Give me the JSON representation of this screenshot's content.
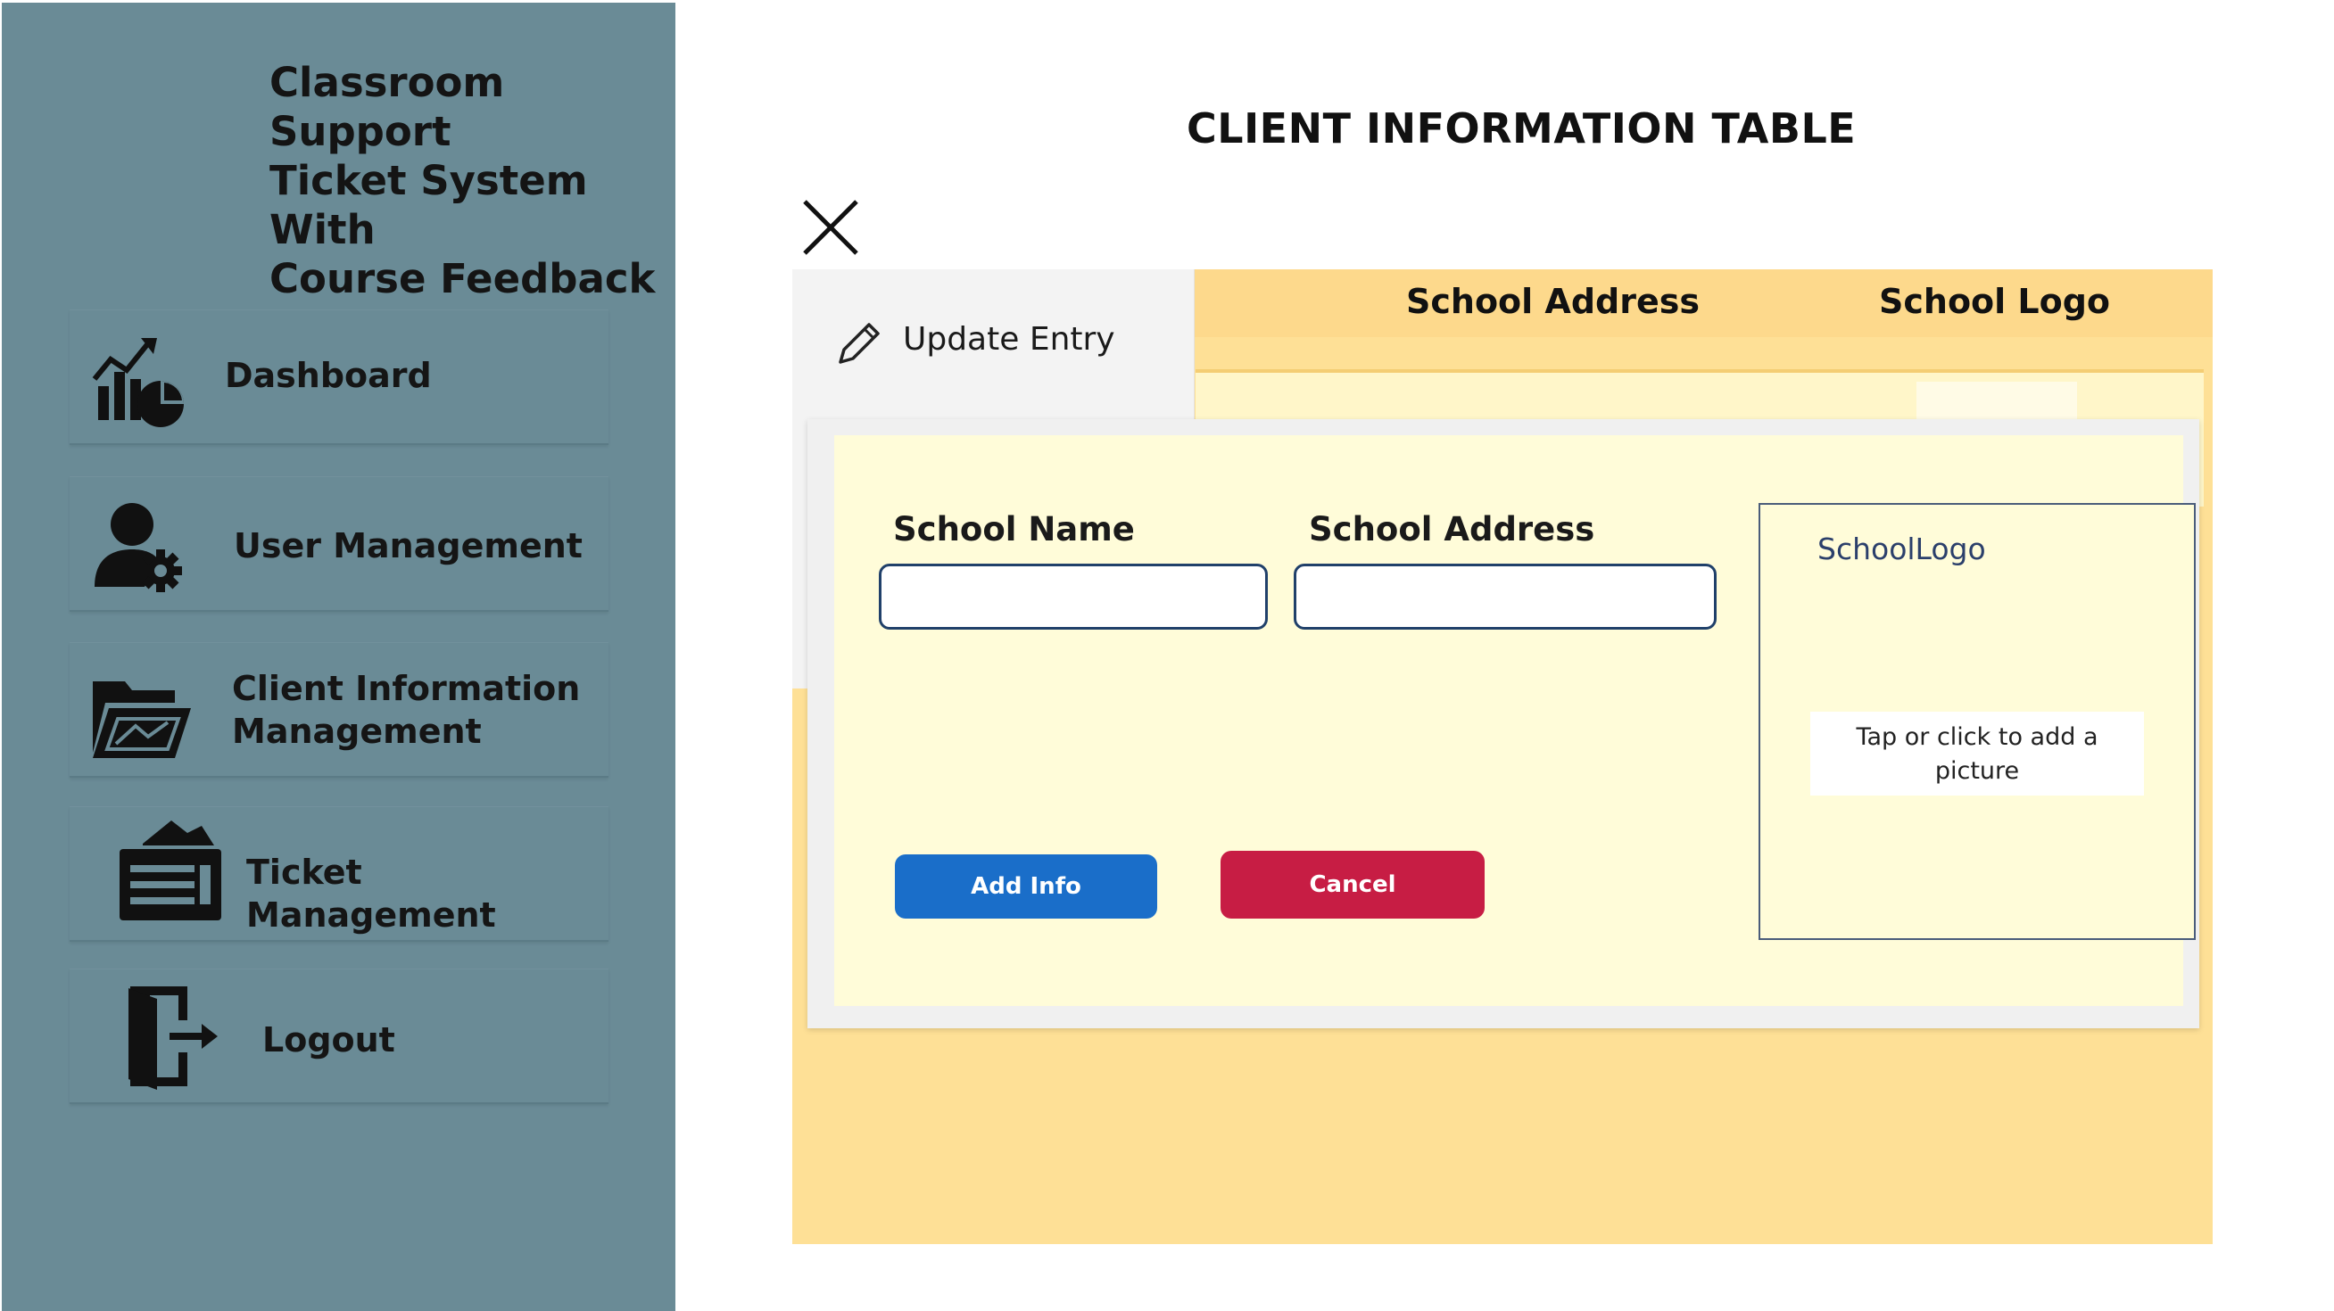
{
  "app": {
    "title_line1": "Classroom Support",
    "title_line2": "Ticket System With",
    "title_line3": "Course Feedback"
  },
  "sidebar": {
    "items": [
      {
        "label": "Dashboard",
        "icon": "dashboard-chart-icon"
      },
      {
        "label": "User Management",
        "icon": "user-settings-icon"
      },
      {
        "label_line1": "Client Information",
        "label_line2": "Management",
        "icon": "open-folder-icon"
      },
      {
        "label": "Ticket Management",
        "icon": "ticket-box-icon"
      },
      {
        "label": "Logout",
        "icon": "logout-door-icon"
      }
    ]
  },
  "main": {
    "page_title": "CLIENT INFORMATION TABLE",
    "table_headers": [
      "School Address",
      "School Logo"
    ],
    "edit_panel": {
      "label": "Update Entry",
      "icon": "pencil-icon"
    }
  },
  "dialog": {
    "school_name_label": "School Name",
    "school_name_value": "",
    "school_address_label": "School Address",
    "school_address_value": "",
    "logo_label": "SchoolLogo",
    "add_picture_line1": "Tap or click to add a",
    "add_picture_line2": "picture",
    "add_button": "Add Info",
    "cancel_button": "Cancel"
  },
  "colors": {
    "sidebar_bg": "#6a8b96",
    "table_bg": "#fee096",
    "dialog_bg": "#fffcd9",
    "add_button": "#1a6ec9",
    "cancel_button": "#c71d44"
  }
}
